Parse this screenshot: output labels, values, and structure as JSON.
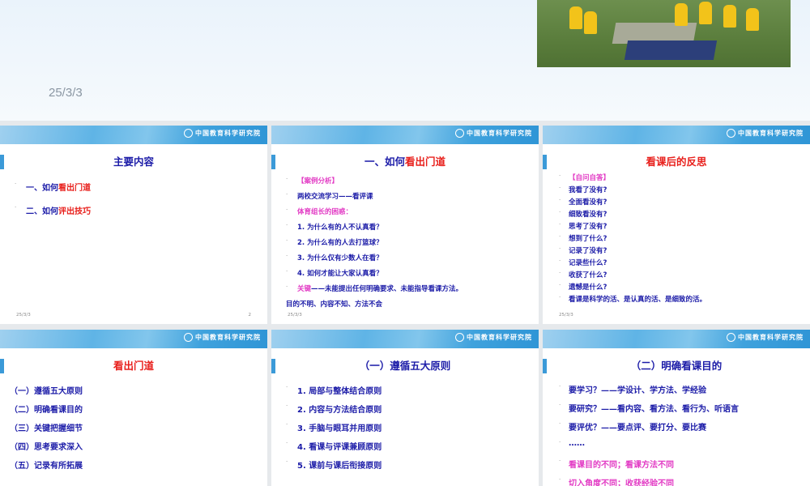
{
  "colors": {
    "blue": "#1c1ca8",
    "red": "#e8201c",
    "magenta": "#e23ac4"
  },
  "top_slide": {
    "date": "25/3/3"
  },
  "logo_text": "中国教育科学研究院",
  "slides": [
    {
      "title": [
        {
          "t": "主要内容",
          "c": "blue"
        }
      ],
      "items": [
        [
          {
            "t": "一、如何",
            "c": "blue"
          },
          {
            "t": "看出门道",
            "c": "red"
          }
        ],
        [
          {
            "t": "二、如何",
            "c": "blue"
          },
          {
            "t": "评出技巧",
            "c": "red"
          }
        ]
      ],
      "date": "25/3/3",
      "page": "2"
    },
    {
      "title": [
        {
          "t": "一、如何",
          "c": "blue"
        },
        {
          "t": "看出门道",
          "c": "red"
        }
      ],
      "items": [
        [
          {
            "t": "【案例分析】",
            "c": "magenta"
          }
        ],
        [
          {
            "t": "两校交流学习——看评课",
            "c": "blue"
          }
        ],
        [
          {
            "t": "体育组长的困惑：",
            "c": "magenta"
          }
        ],
        [
          {
            "t": "1. 为什么有的人不认真看？",
            "c": "blue"
          }
        ],
        [
          {
            "t": "2. 为什么有的人去打篮球？",
            "c": "blue"
          }
        ],
        [
          {
            "t": "3. 为什么仅有少数人在看？",
            "c": "blue"
          }
        ],
        [
          {
            "t": "4. 如何才能让大家认真看？",
            "c": "blue"
          }
        ],
        [
          {
            "t": "关键",
            "c": "magenta"
          },
          {
            "t": "——未能提出任何明确要求、未能指导看课方法。",
            "c": "blue"
          }
        ],
        [
          {
            "t": "目的不明、内容不知、方法不会",
            "c": "blue"
          }
        ]
      ],
      "date": "25/3/3"
    },
    {
      "title": [
        {
          "t": "看课后的反思",
          "c": "red"
        }
      ],
      "items": [
        [
          {
            "t": "【自问自答】",
            "c": "magenta"
          }
        ],
        [
          {
            "t": "我看了没有?",
            "c": "blue"
          }
        ],
        [
          {
            "t": "全面看没有?",
            "c": "blue"
          }
        ],
        [
          {
            "t": "细致看没有?",
            "c": "blue"
          }
        ],
        [
          {
            "t": "思考了没有?",
            "c": "blue"
          }
        ],
        [
          {
            "t": "想到了什么?",
            "c": "blue"
          }
        ],
        [
          {
            "t": "记录了没有?",
            "c": "blue"
          }
        ],
        [
          {
            "t": "记录些什么?",
            "c": "blue"
          }
        ],
        [
          {
            "t": "收获了什么?",
            "c": "blue"
          }
        ],
        [
          {
            "t": "遗憾是什么?",
            "c": "blue"
          }
        ],
        [
          {
            "t": "看课是科学的活、是认真的活、是细致的活。",
            "c": "blue"
          }
        ]
      ],
      "date": "25/3/3"
    },
    {
      "title": [
        {
          "t": "看出门道",
          "c": "red"
        }
      ],
      "items": [
        [
          {
            "t": "（一）遵循五大原则",
            "c": "blue"
          }
        ],
        [
          {
            "t": "（二）明确看课目的",
            "c": "blue"
          }
        ],
        [
          {
            "t": "（三）关键把握细节",
            "c": "blue"
          }
        ],
        [
          {
            "t": "（四）思考要求深入",
            "c": "blue"
          }
        ],
        [
          {
            "t": "（五）记录有所拓展",
            "c": "blue"
          }
        ]
      ]
    },
    {
      "title": [
        {
          "t": "（一）遵循五大原则",
          "c": "blue"
        }
      ],
      "items": [
        [
          {
            "t": "1. 局部与整体结合原则",
            "c": "blue"
          }
        ],
        [
          {
            "t": "2. 内容与方法结合原则",
            "c": "blue"
          }
        ],
        [
          {
            "t": "3. 手脑与眼耳并用原则",
            "c": "blue"
          }
        ],
        [
          {
            "t": "4. 看课与评课兼顾原则",
            "c": "blue"
          }
        ],
        [
          {
            "t": "5. 课前与课后衔接原则",
            "c": "blue"
          }
        ]
      ]
    },
    {
      "title": [
        {
          "t": "（二）明确看课目的",
          "c": "blue"
        }
      ],
      "items": [
        [
          {
            "t": "要学习？——学设计、学方法、学经验",
            "c": "blue"
          }
        ],
        [
          {
            "t": "要研究？——看内容、看方法、看行为、听语言",
            "c": "blue"
          }
        ],
        [
          {
            "t": "要评优？——要点评、要打分、要比赛",
            "c": "blue"
          }
        ],
        [
          {
            "t": "……",
            "c": "blue"
          }
        ],
        [
          {
            "t": "看课目的不同；看课方法不同",
            "c": "magenta"
          }
        ],
        [
          {
            "t": "切入角度不同；收获经验不同",
            "c": "magenta"
          }
        ]
      ]
    }
  ]
}
